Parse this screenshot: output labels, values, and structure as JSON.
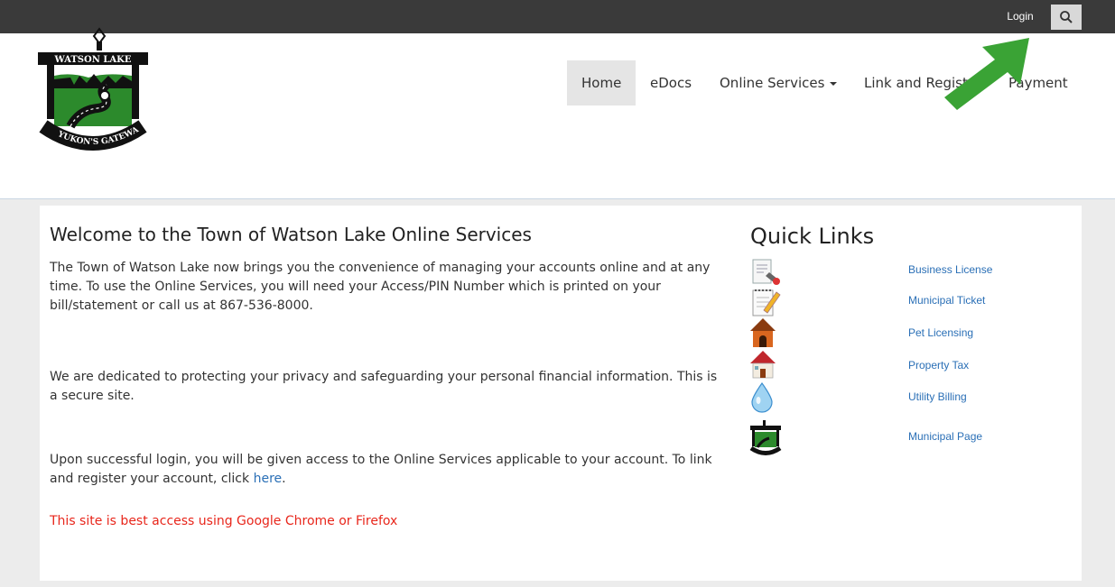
{
  "topbar": {
    "login_label": "Login",
    "search_icon": "search-icon"
  },
  "logo": {
    "alt": "Town of Watson Lake logo",
    "text_top": "WATSON LAKE",
    "text_bottom": "YUKON'S GATEWAY"
  },
  "nav": {
    "items": [
      {
        "label": "Home",
        "active": true
      },
      {
        "label": "eDocs"
      },
      {
        "label": "Online Services",
        "dropdown": true
      },
      {
        "label": "Link and Register"
      },
      {
        "label": "Payment"
      }
    ]
  },
  "main": {
    "title": "Welcome to the Town of Watson Lake Online Services",
    "p1": "The Town of Watson Lake now brings you the convenience of managing your accounts online and at any time.  To use the Online Services, you will need your Access/PIN Number which is printed on your bill/statement or call us at 867-536-8000.",
    "p2": "We are dedicated to protecting your privacy and safeguarding your personal financial information. This is a secure site.",
    "p3_prefix": "Upon successful login, you will be given access to the Online Services applicable to your account. To link and register your account, click ",
    "p3_link": "here",
    "p3_suffix": ".",
    "warning": "This site is best access using Google Chrome or Firefox"
  },
  "quick_links": {
    "title": "Quick Links",
    "items": [
      {
        "label": "Business License",
        "icon": "license-icon"
      },
      {
        "label": "Municipal Ticket",
        "icon": "ticket-icon"
      },
      {
        "label": "Pet Licensing",
        "icon": "doghouse-icon"
      },
      {
        "label": "Property Tax",
        "icon": "house-icon"
      },
      {
        "label": "Utility Billing",
        "icon": "water-drop-icon"
      },
      {
        "label": "Municipal Page",
        "icon": "municipal-logo-icon"
      }
    ]
  },
  "colors": {
    "topbar": "#3a3a3a",
    "link": "#2a6fb6",
    "warning": "#e8261b",
    "annotation_arrow": "#3aa335"
  }
}
